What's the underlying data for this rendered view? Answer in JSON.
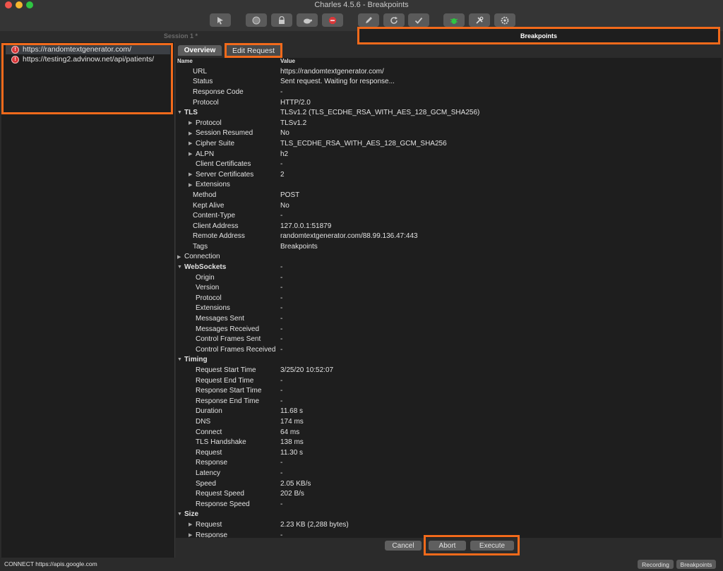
{
  "window": {
    "title": "Charles 4.5.6 - Breakpoints"
  },
  "session": {
    "label": "Session 1 *"
  },
  "breakpoints_tab": {
    "label": "Breakpoints"
  },
  "tree": {
    "items": [
      {
        "label": "https://randomtextgenerator.com/"
      },
      {
        "label": "https://testing2.advinow.net/api/patients/"
      }
    ]
  },
  "tabs": {
    "overview": "Overview",
    "edit_request": "Edit Request"
  },
  "table": {
    "headers": {
      "name": "Name",
      "value": "Value"
    },
    "rows": [
      {
        "name": "URL",
        "value": "https://randomtextgenerator.com/"
      },
      {
        "name": "Status",
        "value": "Sent request. Waiting for response..."
      },
      {
        "name": "Response Code",
        "value": "-"
      },
      {
        "name": "Protocol",
        "value": "HTTP/2.0"
      },
      {
        "name": "TLS",
        "value": "TLSv1.2 (TLS_ECDHE_RSA_WITH_AES_128_GCM_SHA256)"
      },
      {
        "name": "Protocol",
        "value": "TLSv1.2"
      },
      {
        "name": "Session Resumed",
        "value": "No"
      },
      {
        "name": "Cipher Suite",
        "value": "TLS_ECDHE_RSA_WITH_AES_128_GCM_SHA256"
      },
      {
        "name": "ALPN",
        "value": "h2"
      },
      {
        "name": "Client Certificates",
        "value": "-"
      },
      {
        "name": "Server Certificates",
        "value": "2"
      },
      {
        "name": "Extensions",
        "value": ""
      },
      {
        "name": "Method",
        "value": "POST"
      },
      {
        "name": "Kept Alive",
        "value": "No"
      },
      {
        "name": "Content-Type",
        "value": "-"
      },
      {
        "name": "Client Address",
        "value": "127.0.0.1:51879"
      },
      {
        "name": "Remote Address",
        "value": "randomtextgenerator.com/88.99.136.47:443"
      },
      {
        "name": "Tags",
        "value": "Breakpoints"
      },
      {
        "name": "Connection",
        "value": ""
      },
      {
        "name": "WebSockets",
        "value": "-"
      },
      {
        "name": "Origin",
        "value": "-"
      },
      {
        "name": "Version",
        "value": "-"
      },
      {
        "name": "Protocol",
        "value": "-"
      },
      {
        "name": "Extensions",
        "value": "-"
      },
      {
        "name": "Messages Sent",
        "value": "-"
      },
      {
        "name": "Messages Received",
        "value": "-"
      },
      {
        "name": "Control Frames Sent",
        "value": "-"
      },
      {
        "name": "Control Frames Received",
        "value": "-"
      },
      {
        "name": "Timing",
        "value": ""
      },
      {
        "name": "Request Start Time",
        "value": "3/25/20 10:52:07"
      },
      {
        "name": "Request End Time",
        "value": "-"
      },
      {
        "name": "Response Start Time",
        "value": "-"
      },
      {
        "name": "Response End Time",
        "value": "-"
      },
      {
        "name": "Duration",
        "value": "11.68 s"
      },
      {
        "name": "DNS",
        "value": "174 ms"
      },
      {
        "name": "Connect",
        "value": "64 ms"
      },
      {
        "name": "TLS Handshake",
        "value": "138 ms"
      },
      {
        "name": "Request",
        "value": "11.30 s"
      },
      {
        "name": "Response",
        "value": "-"
      },
      {
        "name": "Latency",
        "value": "-"
      },
      {
        "name": "Speed",
        "value": "2.05 KB/s"
      },
      {
        "name": "Request Speed",
        "value": "202 B/s"
      },
      {
        "name": "Response Speed",
        "value": "-"
      },
      {
        "name": "Size",
        "value": ""
      },
      {
        "name": "Request",
        "value": "2.23 KB (2,288 bytes)"
      },
      {
        "name": "Response",
        "value": "-"
      }
    ]
  },
  "buttons": {
    "cancel": "Cancel",
    "abort": "Abort",
    "execute": "Execute"
  },
  "status": {
    "text": "CONNECT https://apis.google.com",
    "recording": "Recording",
    "breakpoints": "Breakpoints"
  },
  "colors": {
    "highlight": "#f26a1b",
    "background": "#1e1e1e",
    "breakpoint_icon": "#d9383a"
  },
  "icons": [
    "pointer-icon",
    "record-icon",
    "throttle-lock-icon",
    "turtle-icon",
    "stop-icon",
    "pen-icon",
    "refresh-icon",
    "check-icon",
    "bug-icon",
    "tools-icon",
    "settings-icon"
  ]
}
